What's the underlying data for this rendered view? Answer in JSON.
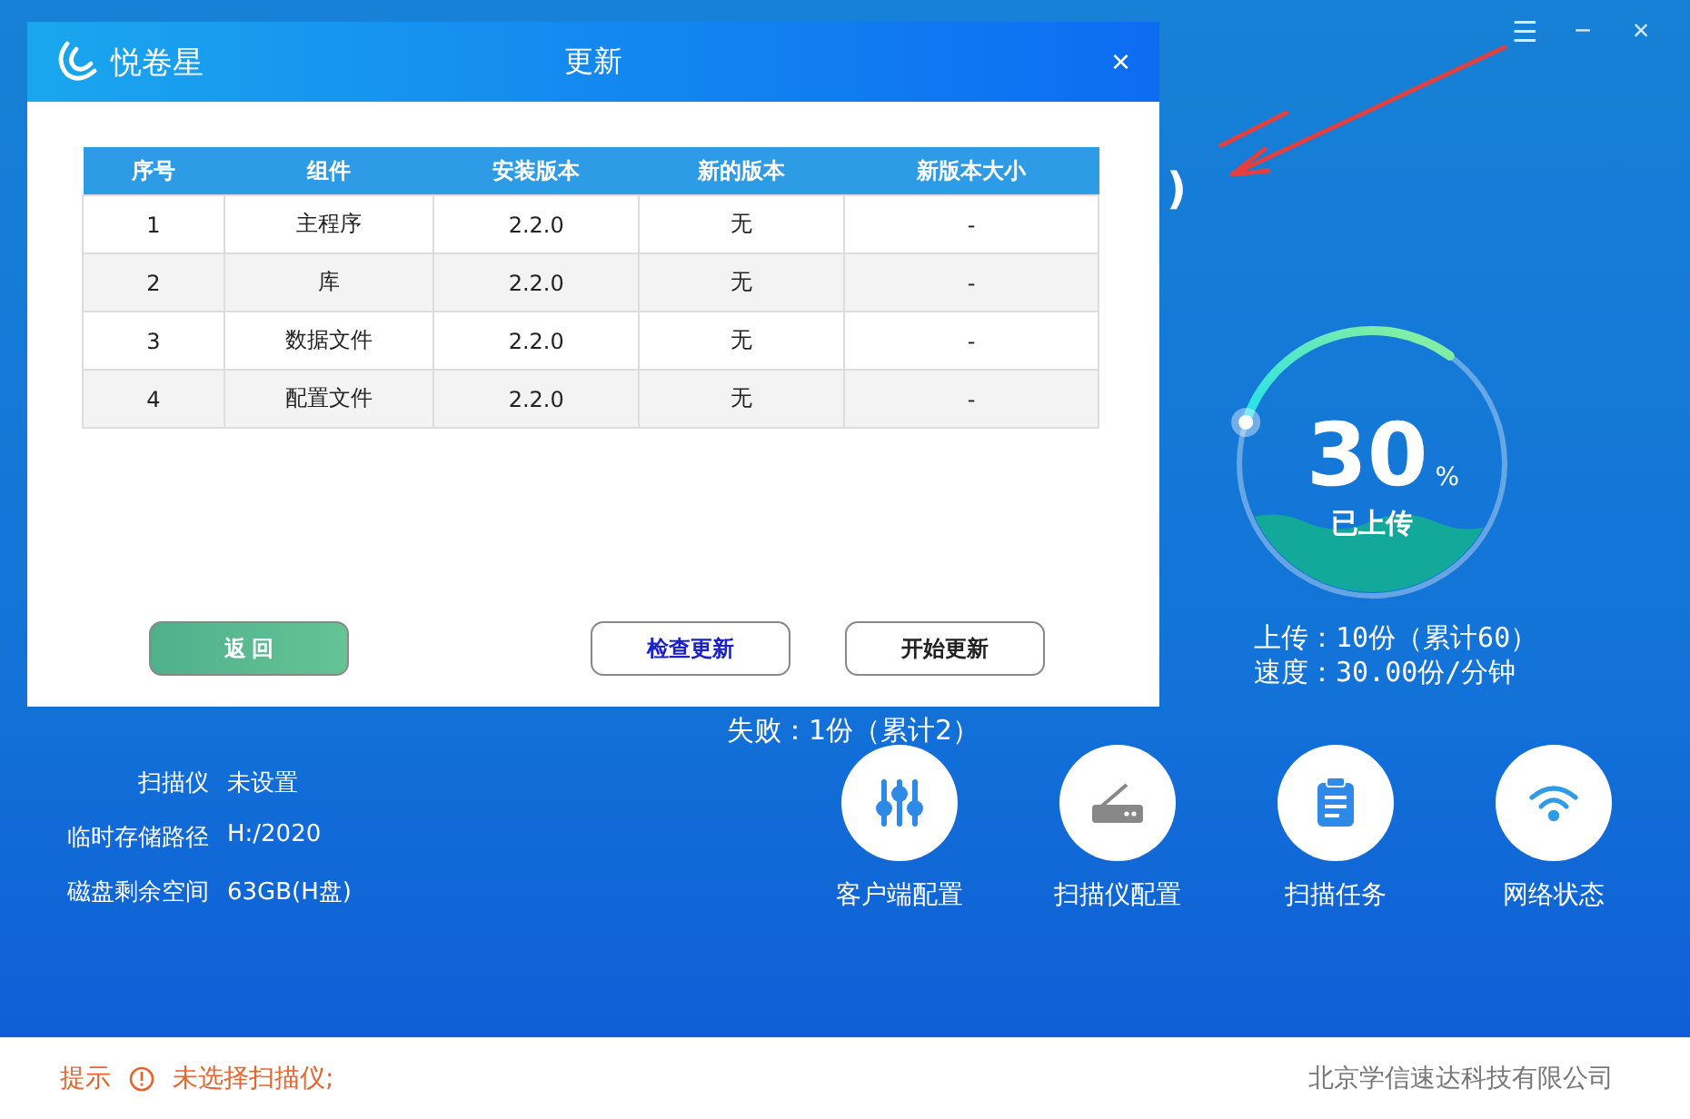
{
  "window": {
    "controls": [
      "☰",
      "−",
      "×"
    ]
  },
  "main": {
    "partial_text": ")",
    "failed_text": "失败：1份（累计2）",
    "gauge": {
      "value": "30",
      "unit": "%",
      "caption": "已上传"
    },
    "stats": [
      "上传：10份（累计60）",
      "速度：30.00份/分钟"
    ],
    "info": [
      {
        "label": "扫描仪",
        "value": "未设置"
      },
      {
        "label": "临时存储路径",
        "value": "H:/2020"
      },
      {
        "label": "磁盘剩余空间",
        "value": "63GB(H盘)"
      }
    ],
    "actions": [
      {
        "kind": "sliders",
        "label": "客户端配置"
      },
      {
        "kind": "router",
        "label": "扫描仪配置"
      },
      {
        "kind": "clipboard",
        "label": "扫描任务"
      },
      {
        "kind": "wifi",
        "label": "网络状态"
      }
    ]
  },
  "status_bar": {
    "hint_label": "提示",
    "message": "未选择扫描仪;",
    "company": "北京学信速达科技有限公司"
  },
  "dialog": {
    "app_name": "悦卷星",
    "title": "更新",
    "close": "×",
    "table": {
      "columns": [
        "序号",
        "组件",
        "安装版本",
        "新的版本",
        "新版本大小"
      ],
      "rows": [
        [
          "1",
          "主程序",
          "2.2.0",
          "无",
          "-"
        ],
        [
          "2",
          "库",
          "2.2.0",
          "无",
          "-"
        ],
        [
          "3",
          "数据文件",
          "2.2.0",
          "无",
          "-"
        ],
        [
          "4",
          "配置文件",
          "2.2.0",
          "无",
          "-"
        ]
      ]
    },
    "buttons": [
      {
        "kind": "back",
        "label": "返 回"
      },
      {
        "kind": "check",
        "label": "检查更新"
      },
      {
        "kind": "start",
        "label": "开始更新"
      }
    ]
  }
}
